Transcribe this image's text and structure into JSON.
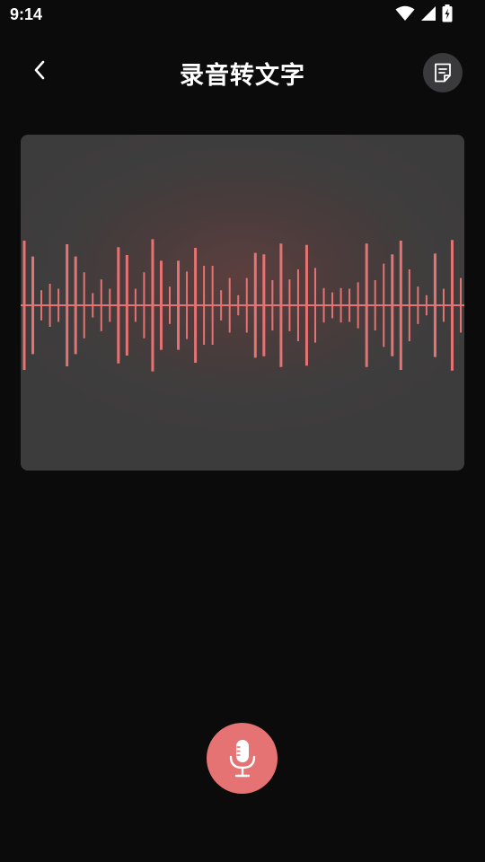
{
  "status_bar": {
    "time": "9:14",
    "icons": [
      "wifi-icon",
      "cellular-signal-icon",
      "battery-charging-icon"
    ]
  },
  "header": {
    "title": "录音转文字",
    "back_icon": "chevron-left-icon",
    "notes_icon": "notes-document-icon"
  },
  "waveform": {
    "color": "#e57373",
    "amplitudes": [
      0.9,
      0.68,
      0.21,
      0.3,
      0.23,
      0.85,
      0.68,
      0.46,
      0.17,
      0.36,
      0.23,
      0.81,
      0.7,
      0.23,
      0.46,
      0.92,
      0.62,
      0.26,
      0.62,
      0.47,
      0.8,
      0.55,
      0.55,
      0.21,
      0.38,
      0.14,
      0.38,
      0.73,
      0.71,
      0.35,
      0.86,
      0.36,
      0.5,
      0.84,
      0.52,
      0.24,
      0.18,
      0.24,
      0.23,
      0.32,
      0.86,
      0.35,
      0.58,
      0.71,
      0.9,
      0.5,
      0.26,
      0.14,
      0.72,
      0.23,
      0.91,
      0.38
    ]
  },
  "record": {
    "icon": "microphone-icon",
    "background": "#e57373"
  }
}
